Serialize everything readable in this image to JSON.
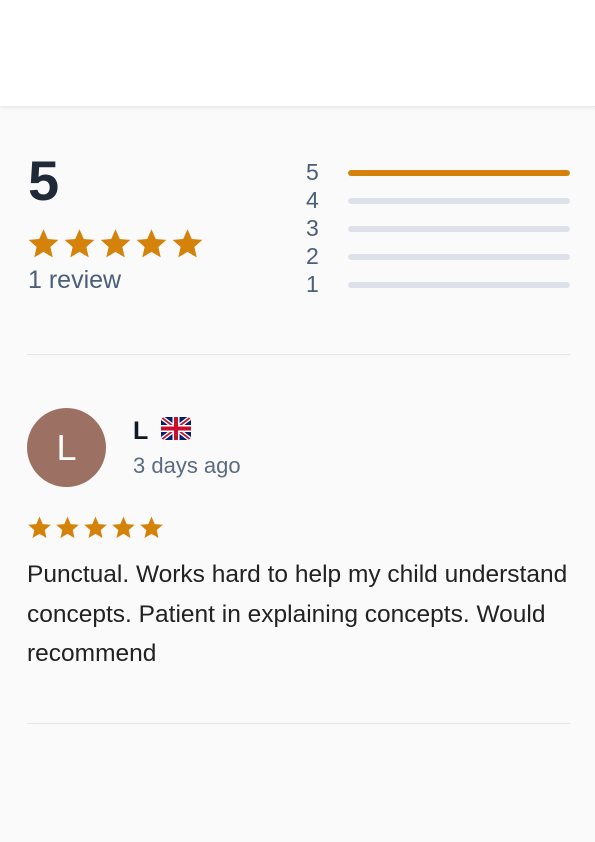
{
  "summary": {
    "average": "5",
    "rating": 5,
    "max_rating": 5,
    "review_count_label": "1 review",
    "histogram": [
      {
        "label": "5",
        "fraction": 1.0
      },
      {
        "label": "4",
        "fraction": 0.0
      },
      {
        "label": "3",
        "fraction": 0.0
      },
      {
        "label": "2",
        "fraction": 0.0
      },
      {
        "label": "1",
        "fraction": 0.0
      }
    ]
  },
  "review": {
    "avatar_initial": "L",
    "reviewer_name": "L",
    "flag_icon": "uk-flag-icon",
    "date": "3 days ago",
    "rating": 5,
    "text": "Punctual.  Works hard to help my child understand concepts. Patient in explaining concepts. Would recommend"
  },
  "colors": {
    "star": "#d4820a",
    "bar_fill": "#d4820a",
    "bar_track": "#dde2ea",
    "avatar_bg": "#9c7163"
  },
  "icons": {
    "star": "star-icon"
  }
}
